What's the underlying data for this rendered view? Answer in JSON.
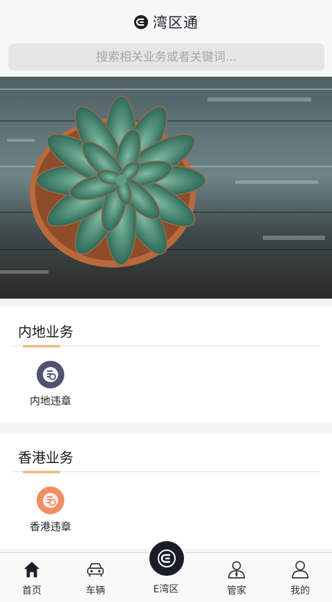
{
  "app": {
    "title": "湾区通"
  },
  "search": {
    "placeholder": "搜索相关业务或者关键词..."
  },
  "banner": {
    "slide_count": 5,
    "active_index": 3
  },
  "sections": [
    {
      "title": "内地业务",
      "items": [
        {
          "label": "内地违章",
          "icon": "violation-icon",
          "color": "#4e5370"
        }
      ]
    },
    {
      "title": "香港业务",
      "items": [
        {
          "label": "香港违章",
          "icon": "violation-icon",
          "color": "#f08e63"
        }
      ]
    }
  ],
  "nav": {
    "items": [
      {
        "label": "首页",
        "icon": "home-icon",
        "active": true
      },
      {
        "label": "车辆",
        "icon": "car-icon"
      },
      {
        "label": "E湾区",
        "icon": "e-logo-icon"
      },
      {
        "label": "管家",
        "icon": "butler-icon"
      },
      {
        "label": "我的",
        "icon": "user-icon"
      }
    ]
  },
  "colors": {
    "brand_dark": "#1a1c28",
    "accent_gold": "#e8c18f",
    "dot_active": "#f3c39a"
  }
}
